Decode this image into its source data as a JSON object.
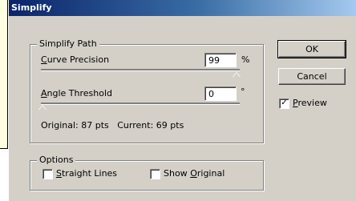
{
  "window": {
    "title": "Simplify"
  },
  "simplify_path": {
    "legend": "Simplify Path",
    "curve_precision": {
      "label_mnemonic": "C",
      "label_rest": "urve Precision",
      "value": "99",
      "unit": "%",
      "slider_percent": 99
    },
    "angle_threshold": {
      "label_mnemonic": "A",
      "label_rest": "ngle Threshold",
      "value": "0",
      "unit": "°",
      "slider_percent": 0
    },
    "status": "Original: 87 pts   Current: 69 pts"
  },
  "buttons": {
    "ok": "OK",
    "cancel": "Cancel"
  },
  "preview": {
    "checked": true,
    "check_glyph": "✓",
    "label_mnemonic": "P",
    "label_rest": "review"
  },
  "options": {
    "legend": "Options",
    "straight_lines": {
      "checked": false,
      "label_mnemonic": "S",
      "label_rest": "traight Lines"
    },
    "show_original": {
      "checked": false,
      "label_before": "Show ",
      "label_mnemonic": "O",
      "label_rest": "riginal"
    }
  }
}
